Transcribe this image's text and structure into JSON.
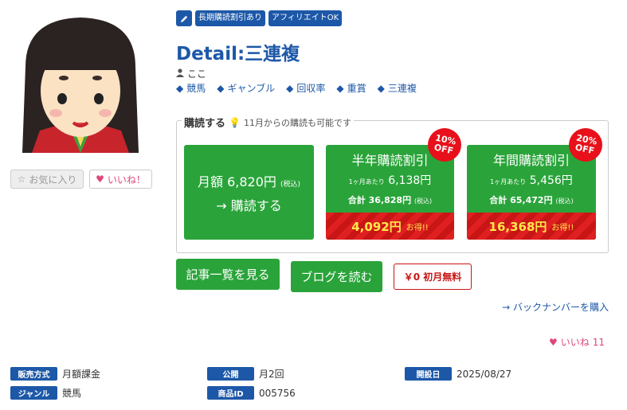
{
  "badges": [
    "長期購読割引あり",
    "アフィリエイトOK"
  ],
  "icons": {
    "pen": "pencil-icon",
    "user": "user-icon",
    "tag": "tag-icon",
    "bulb": "lightbulb-icon",
    "heart": "heart-icon",
    "star": "star-icon",
    "arrow": "arrow-right-icon"
  },
  "title": "Detail:三連複",
  "author": "ここ",
  "tags": [
    "競馬",
    "ギャンブル",
    "回収率",
    "重賞",
    "三連複"
  ],
  "sidebar": {
    "fav_label": "お気に入り",
    "like_label": "いいね！"
  },
  "subscribe": {
    "legend": "購読する",
    "note": "11月からの購読も可能です",
    "monthly": {
      "prefix": "月額",
      "price": "6,820円",
      "tax": "(税込)",
      "action": "→ 購読する"
    },
    "half": {
      "title": "半年購読割引",
      "per_prefix": "1ヶ月あたり",
      "per_price": "6,138円",
      "total_prefix": "合計",
      "total": "36,828円",
      "tax": "(税込)",
      "save": "4,092円",
      "otoku": "お得!!",
      "off_pct": "10%",
      "off": "OFF"
    },
    "year": {
      "title": "年間購読割引",
      "per_prefix": "1ヶ月あたり",
      "per_price": "5,456円",
      "total_prefix": "合計",
      "total": "65,472円",
      "tax": "(税込)",
      "save": "16,368円",
      "otoku": "お得!!",
      "off_pct": "20%",
      "off": "OFF"
    }
  },
  "actions": {
    "list": "記事一覧を見る",
    "blog": "ブログを読む",
    "free": "￥0 初月無料"
  },
  "backnumber": "→ バックナンバーを購入",
  "likes": {
    "label": "いいね",
    "count": "11"
  },
  "meta": {
    "sales_label": "販売方式",
    "sales": "月額課金",
    "genre_label": "ジャンル",
    "genre": "競馬",
    "pub_label": "公開",
    "pub": "月2回",
    "id_label": "商品ID",
    "id": "005756",
    "start_label": "開設日",
    "start": "2025/08/27"
  },
  "colors": {
    "brand": "#1d58a8",
    "green": "#2aa43a",
    "red": "#e02020",
    "pink": "#e0457b"
  }
}
